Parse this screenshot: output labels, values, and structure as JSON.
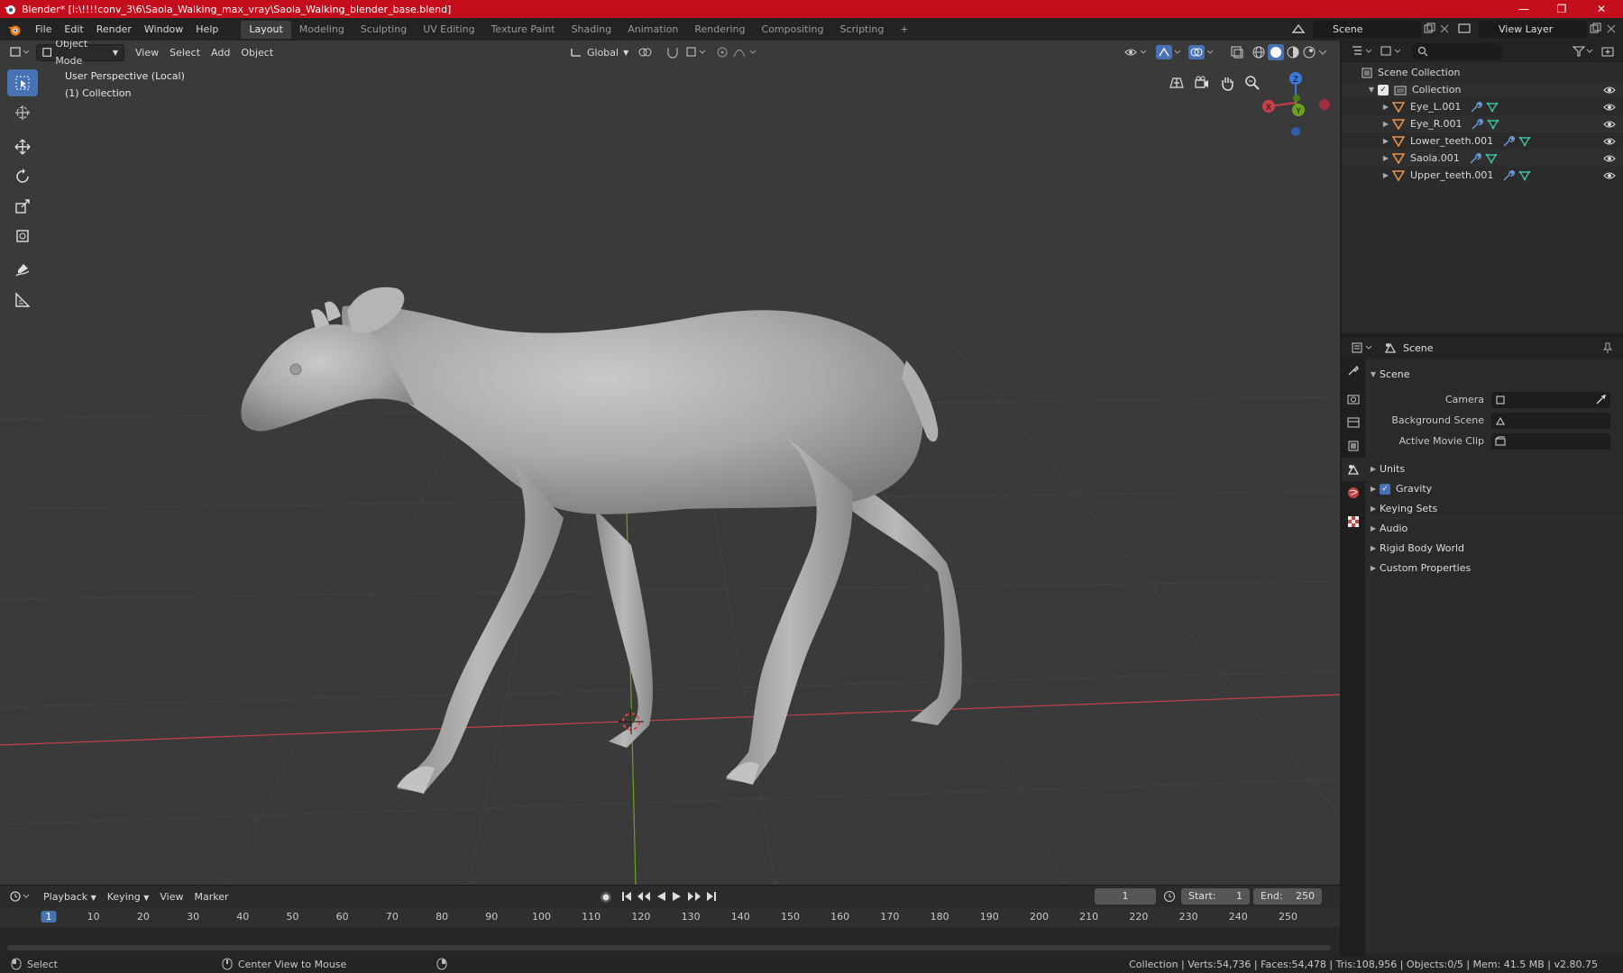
{
  "window": {
    "title": "Blender* [I:\\!!!!conv_3\\6\\Saola_Walking_max_vray\\Saola_Walking_blender_base.blend]",
    "minimize": "—",
    "maximize": "❐",
    "close": "✕"
  },
  "menu": [
    "File",
    "Edit",
    "Render",
    "Window",
    "Help"
  ],
  "workspaces": [
    "Layout",
    "Modeling",
    "Sculpting",
    "UV Editing",
    "Texture Paint",
    "Shading",
    "Animation",
    "Rendering",
    "Compositing",
    "Scripting"
  ],
  "active_workspace": "Layout",
  "add_workspace": "+",
  "scene_field": "Scene",
  "view_layer_field": "View Layer",
  "viewport": {
    "mode": "Object Mode",
    "menus": [
      "View",
      "Select",
      "Add",
      "Object"
    ],
    "transform_orientation": "Global",
    "overlay_line1": "User Perspective (Local)",
    "overlay_line2": "(1) Collection",
    "gizmo": {
      "x": "X",
      "y": "Y",
      "z": "Z"
    }
  },
  "timeline": {
    "menus": [
      "Playback",
      "Keying",
      "View",
      "Marker"
    ],
    "current_frame": "1",
    "start_label": "Start:",
    "start_value": "1",
    "end_label": "End:",
    "end_value": "250",
    "ticks": [
      "1",
      "10",
      "20",
      "30",
      "40",
      "50",
      "60",
      "70",
      "80",
      "90",
      "100",
      "110",
      "120",
      "130",
      "140",
      "150",
      "160",
      "170",
      "180",
      "190",
      "200",
      "210",
      "220",
      "230",
      "240",
      "250"
    ]
  },
  "statusbar": {
    "select": "Select",
    "center_view": "Center View to Mouse",
    "stats": "Collection | Verts:54,736 | Faces:54,478 | Tris:108,956 | Objects:0/5 | Mem: 41.5 MB | v2.80.75"
  },
  "outliner": {
    "root": "Scene Collection",
    "collection": "Collection",
    "objects": [
      "Eye_L.001",
      "Eye_R.001",
      "Lower_teeth.001",
      "Saola.001",
      "Upper_teeth.001"
    ]
  },
  "properties": {
    "header": "Scene",
    "panel": "Scene",
    "camera_label": "Camera",
    "background_scene_label": "Background Scene",
    "active_movie_clip_label": "Active Movie Clip",
    "subpanels": [
      "Units",
      "Gravity",
      "Keying Sets",
      "Audio",
      "Rigid Body World",
      "Custom Properties"
    ]
  },
  "colors": {
    "titlebar": "#c40e1e",
    "accent": "#4772b3",
    "viewport_bg": "#3a3a3a",
    "x_axis": "#c7404a",
    "y_axis": "#6ea020",
    "z_axis": "#3b78d8",
    "mesh": "#a8a8a8"
  }
}
